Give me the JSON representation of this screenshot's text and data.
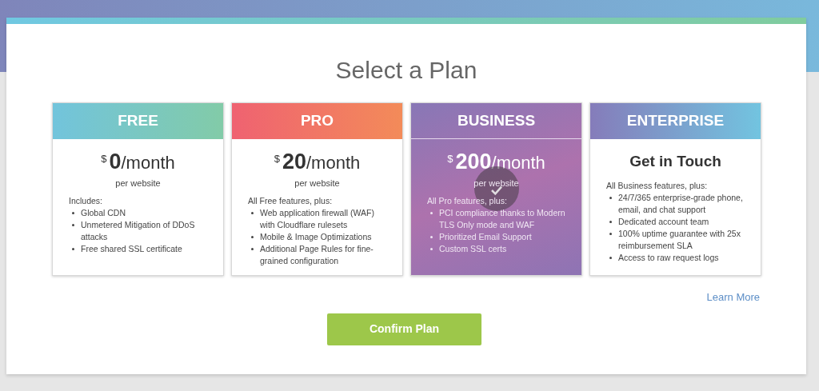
{
  "title": "Select a Plan",
  "plans": [
    {
      "name": "FREE",
      "selected": false,
      "currency": "$",
      "amount": "0",
      "period": "/month",
      "unit": "per website",
      "intro": "Includes:",
      "features": [
        "Global CDN",
        "Unmetered Mitigation of DDoS attacks",
        "Free shared SSL certificate"
      ]
    },
    {
      "name": "PRO",
      "selected": false,
      "currency": "$",
      "amount": "20",
      "period": "/month",
      "unit": "per website",
      "intro": "All Free features, plus:",
      "features": [
        "Web application firewall (WAF) with Cloudflare rulesets",
        "Mobile & Image Optimizations",
        "Additional Page Rules for fine-grained configuration"
      ]
    },
    {
      "name": "BUSINESS",
      "selected": true,
      "currency": "$",
      "amount": "200",
      "period": "/month",
      "unit": "per website",
      "intro": "All Pro features, plus:",
      "features": [
        "PCI compliance thanks to Modern TLS Only mode and WAF",
        "Prioritized Email Support",
        "Custom SSL certs"
      ]
    },
    {
      "name": "ENTERPRISE",
      "selected": false,
      "headline": "Get in Touch",
      "intro": "All Business features, plus:",
      "features": [
        "24/7/365 enterprise-grade phone, email, and chat support",
        "Dedicated account team",
        "100% uptime guarantee with 25x reimbursement SLA",
        "Access to raw request logs"
      ]
    }
  ],
  "learn_more": "Learn More",
  "confirm_button": "Confirm Plan"
}
